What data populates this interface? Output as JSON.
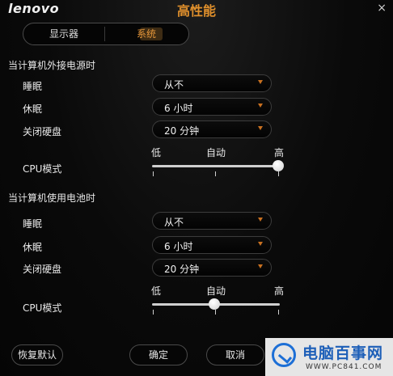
{
  "window": {
    "logo": "lenovo",
    "title": "高性能",
    "close": "×"
  },
  "tabs": [
    {
      "label": "显示器"
    },
    {
      "label": "系统"
    }
  ],
  "ac": {
    "section": "当计算机外接电源时",
    "sleep": {
      "label": "睡眠",
      "value": "从不"
    },
    "hibernate": {
      "label": "休眠",
      "value": "6 小时"
    },
    "disk": {
      "label": "关闭硬盘",
      "value": "20 分钟"
    },
    "cpu": {
      "label": "CPU模式",
      "ticks": [
        "低",
        "自动",
        "高"
      ],
      "level": "高"
    }
  },
  "battery": {
    "section": "当计算机使用电池时",
    "sleep": {
      "label": "睡眠",
      "value": "从不"
    },
    "hibernate": {
      "label": "休眠",
      "value": "6 小时"
    },
    "disk": {
      "label": "关闭硬盘",
      "value": "20 分钟"
    },
    "cpu": {
      "label": "CPU模式",
      "ticks": [
        "低",
        "自动",
        "高"
      ],
      "level": "自动"
    }
  },
  "buttons": {
    "restore": "恢复默认",
    "ok": "确定",
    "cancel": "取消"
  },
  "watermark": {
    "brand": "电脑百事网",
    "url": "WWW.PC841.COM"
  },
  "colors": {
    "accent": "#e0902c",
    "arrow": "#c87020",
    "watermark": "#1d5fb8"
  }
}
